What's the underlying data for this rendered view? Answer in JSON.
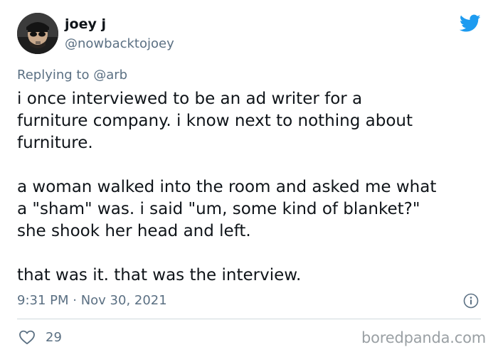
{
  "tweet": {
    "display_name": "joey j",
    "handle": "@nowbacktojoey",
    "reply_prefix": "Replying to",
    "reply_mention": "@arb",
    "paragraphs": [
      [
        "i once interviewed to be an ad writer for a",
        "furniture company. i know next to nothing about",
        "furniture."
      ],
      [
        "a woman walked into the room and asked me what",
        "a \"sham\" was. i said \"um, some kind of blanket?\"",
        "she shook her head and left."
      ],
      [
        "that was it. that was the interview."
      ]
    ],
    "timestamp": "9:31 PM · Nov 30, 2021",
    "like_count": "29"
  },
  "watermark": "boredpanda.com",
  "colors": {
    "twitter_blue": "#1d9bf0",
    "secondary_text": "#5b7083",
    "divider": "#cfd9de",
    "watermark": "#9aa0a4"
  },
  "icons": [
    "avatar",
    "twitter-bird-icon",
    "info-icon",
    "heart-icon"
  ]
}
